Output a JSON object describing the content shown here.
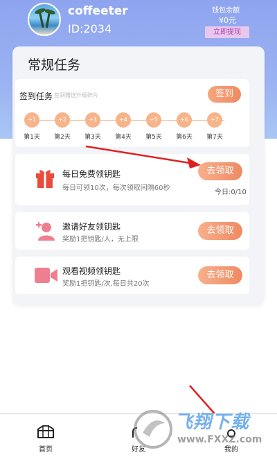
{
  "header": {
    "username": "coffeeter",
    "user_id": "ID:2034",
    "wallet_label": "钱包余额",
    "wallet_amount": "¥0元",
    "withdraw_label": "立即提现"
  },
  "card": {
    "title": "常规任务"
  },
  "signin": {
    "title": "签到任务",
    "note": "签到赠送升级碎片",
    "button_label": "签到",
    "days": [
      {
        "bonus": "+1",
        "label": "第1天"
      },
      {
        "bonus": "+2",
        "label": "第2天"
      },
      {
        "bonus": "+3",
        "label": "第3天"
      },
      {
        "bonus": "+4",
        "label": "第4天"
      },
      {
        "bonus": "+5",
        "label": "第5天"
      },
      {
        "bonus": "+6",
        "label": "第6天"
      },
      {
        "bonus": "+7",
        "label": "第7天"
      }
    ]
  },
  "tasks": [
    {
      "title": "每日免费领钥匙",
      "desc": "每日可领10次，每次领取间隔60秒",
      "button": "去领取",
      "count": "今日:0/10",
      "icon": "gift-icon"
    },
    {
      "title": "邀请好友领钥匙",
      "desc": "奖励1把钥匙/人，无上限",
      "button": "去领取",
      "icon": "add-friend-icon"
    },
    {
      "title": "观看视频领钥匙",
      "desc": "奖励1把钥匙/次,每日共20次",
      "button": "去领取",
      "icon": "video-camera-icon"
    }
  ],
  "tabbar": [
    {
      "label": "首页",
      "icon": "treasure-chest-icon"
    },
    {
      "label": "好友",
      "icon": "friends-icon"
    },
    {
      "label": "我的",
      "icon": "profile-icon"
    }
  ],
  "watermark": {
    "text": "飞翔下载",
    "url": "www.FXXZ.com"
  },
  "colors": {
    "accent_orange": "#ef8a60",
    "header_blue": "#8fa4ef",
    "icon_red": "#e84c3d",
    "icon_pink": "#ee7f8e"
  }
}
